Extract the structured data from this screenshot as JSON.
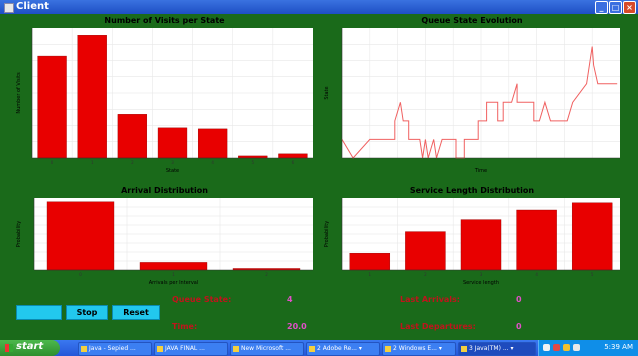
{
  "window": {
    "title": "Client",
    "min": "_",
    "max": "□",
    "close": "×"
  },
  "charts": {
    "visits": {
      "title": "Number of Visits per State",
      "xlabel": "State",
      "ylabel": "Number of Visits"
    },
    "queue": {
      "title": "Queue State Evolution",
      "xlabel": "Time",
      "ylabel": "State"
    },
    "arrival": {
      "title": "Arrival Distribution",
      "xlabel": "Arrivals per Interval",
      "ylabel": "Probability"
    },
    "service": {
      "title": "Service Length Distribution",
      "xlabel": "Service length",
      "ylabel": "Probability"
    }
  },
  "chart_data": [
    {
      "id": "visits",
      "type": "bar",
      "categories": [
        "0",
        "1",
        "2",
        "3",
        "4",
        "5",
        "6"
      ],
      "values": [
        9.8,
        11.8,
        4.2,
        2.9,
        2.8,
        0.2,
        0.4
      ],
      "ylim": [
        0,
        12.5
      ],
      "grid": true,
      "color": "#e80000"
    },
    {
      "id": "queue",
      "type": "line",
      "x": [
        0,
        0.4,
        0.4,
        1,
        1,
        1.9,
        1.9,
        2.1,
        2.2,
        2.4,
        2.4,
        2.8,
        2.9,
        3.0,
        3.1,
        3.3,
        3.4,
        3.6,
        3.7,
        4.1,
        4.1,
        4.4,
        4.4,
        4.9,
        4.9,
        5.2,
        5.2,
        5.6,
        5.6,
        5.8,
        5.8,
        6.1,
        6.3,
        6.3,
        6.6,
        6.9,
        6.9,
        7.1,
        7.3,
        7.5,
        7.5,
        8.1,
        8.3,
        8.3,
        8.8,
        8.8,
        9.0,
        9.05,
        9.2,
        9.3,
        9.5,
        9.9
      ],
      "y": [
        1,
        0,
        0,
        1,
        1,
        1,
        2,
        3,
        2,
        2,
        1,
        1,
        0,
        1,
        0,
        1,
        0,
        1,
        1,
        1,
        0,
        0,
        1,
        1,
        2,
        2,
        3,
        3,
        2,
        2,
        3,
        3,
        4,
        3,
        3,
        3,
        2,
        2,
        3,
        2,
        2,
        2,
        3,
        3,
        4,
        4,
        6,
        5,
        4,
        4,
        4,
        4
      ],
      "ylim": [
        0,
        7
      ],
      "grid": true,
      "color": "#f06060"
    },
    {
      "id": "arrival",
      "type": "bar",
      "categories": [
        "0",
        "1",
        "2"
      ],
      "values": [
        0.9,
        0.1,
        0.02
      ],
      "ylim": [
        0,
        0.95
      ],
      "grid": true,
      "color": "#e80000"
    },
    {
      "id": "service",
      "type": "bar",
      "categories": [
        "1",
        "2",
        "3",
        "4",
        "5"
      ],
      "values": [
        0.07,
        0.16,
        0.21,
        0.25,
        0.28
      ],
      "ylim": [
        0,
        0.3
      ],
      "grid": true,
      "color": "#e80000"
    }
  ],
  "controls": {
    "start_label": "",
    "stop_label": "Stop",
    "reset_label": "Reset"
  },
  "stats": {
    "queue_state_label": "Queue State:",
    "queue_state_value": "4",
    "time_label": "Time:",
    "time_value": "20.0",
    "last_arrivals_label": "Last Arrivals:",
    "last_arrivals_value": "0",
    "last_departures_label": "Last Departures:",
    "last_departures_value": "0"
  },
  "taskbar": {
    "start_label": "start",
    "tasks": [
      "Java - Sepied ...",
      "JAVA FINAL ...",
      "New Microsoft ...",
      "2 Adobe Re... ▾",
      "2 Windows E... ▾",
      "3 Java(TM) ... ▾"
    ],
    "clock": "5:39 AM"
  }
}
